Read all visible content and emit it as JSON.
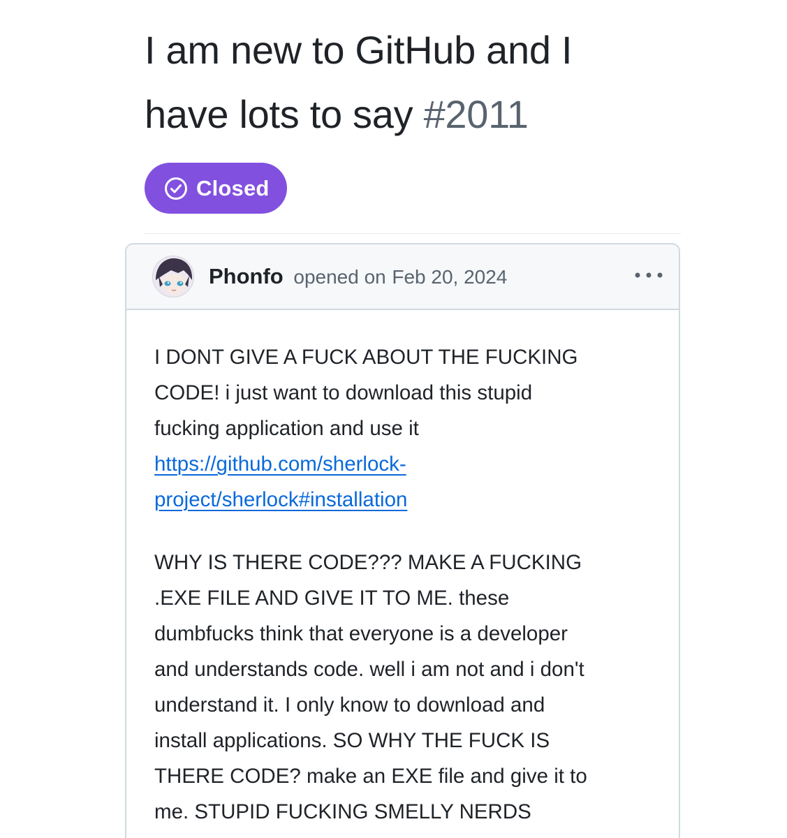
{
  "issue": {
    "title": "I am new to GitHub and I have lots to say",
    "number": "#2011",
    "state_label": "Closed",
    "state_icon": "check-circle-icon",
    "state_color": "#8250df"
  },
  "comment": {
    "author": "Phonfo",
    "opened_text": "opened on",
    "date": "Feb 20, 2024",
    "menu_icon": "kebab-horizontal-icon",
    "paragraph1_lines": [
      "I DONT GIVE A FUCK ABOUT THE FUCKING",
      "CODE! i just want to download this stupid",
      "fucking application and use it"
    ],
    "link_lines": [
      "https://github.com/sherlock-",
      "project/sherlock#installation"
    ],
    "link_color": "#0969da",
    "paragraph2_lines": [
      "WHY IS THERE CODE??? MAKE A FUCKING",
      ".EXE FILE AND GIVE IT TO ME. these",
      "dumbfucks think that everyone is a developer",
      "and understands code. well i am not and i don't",
      "understand it. I only know to download and",
      "install applications. SO WHY THE FUCK IS",
      "THERE CODE? make an EXE file and give it to",
      "me. STUPID FUCKING SMELLY NERDS"
    ]
  }
}
